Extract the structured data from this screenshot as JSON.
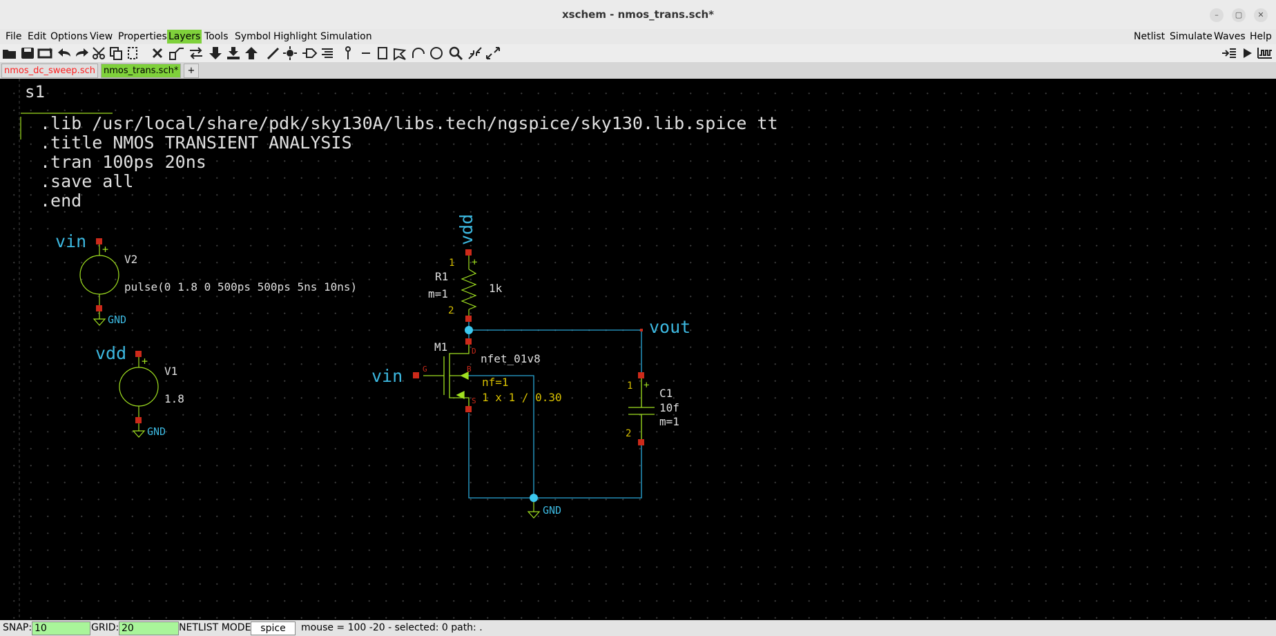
{
  "window": {
    "title": "xschem - nmos_trans.sch*"
  },
  "menubar": {
    "left": [
      "File",
      "Edit",
      "Options",
      "View",
      "Properties",
      "Layers",
      "Tools",
      "Symbol",
      "Highlight",
      "Simulation"
    ],
    "right": [
      "Netlist",
      "Simulate",
      "Waves",
      "Help"
    ],
    "highlighted": "Layers"
  },
  "tabs": [
    {
      "label": "nmos_dc_sweep.sch",
      "color": "#ff2020"
    },
    {
      "label": "nmos_trans.sch*",
      "active": true
    },
    {
      "label": "+"
    }
  ],
  "schematic": {
    "code_block": {
      "name": "s1",
      "lines": [
        ".lib /usr/local/share/pdk/sky130A/libs.tech/ngspice/sky130.lib.spice tt",
        ".title NMOS TRANSIENT ANALYSIS",
        ".tran 100ps 20ns",
        ".save all",
        ".end"
      ]
    },
    "v2": {
      "name": "V2",
      "value": "pulse(0 1.8 0 500ps 500ps 5ns 10ns)",
      "net_top": "vin",
      "net_bottom": "GND"
    },
    "v1": {
      "name": "V1",
      "value": "1.8",
      "net_top": "vdd",
      "net_bottom": "GND"
    },
    "r1": {
      "name": "R1",
      "mult": "m=1",
      "value": "1k",
      "pin1": "1",
      "pin2": "2",
      "net_top": "vdd"
    },
    "m1": {
      "name": "M1",
      "model": "nfet_01v8",
      "nf": "nf=1",
      "size": "1 x 1 / 0.30",
      "pin_d": "D",
      "pin_g": "G",
      "pin_b": "B",
      "pin_s": "S",
      "net_gate": "vin"
    },
    "c1": {
      "name": "C1",
      "value": "10f",
      "mult": "m=1",
      "pin1": "1",
      "pin2": "2"
    },
    "net_out": "vout",
    "gnd_bottom": "GND"
  },
  "status": {
    "snap_label": "SNAP:",
    "snap_value": "10",
    "grid_label": "GRID:",
    "grid_value": "20",
    "netlist_label": "NETLIST MODE:",
    "netlist_value": "spice",
    "message": "mouse = 100 -20 - selected: 0 path: ."
  },
  "colors": {
    "wire": "#2aa8d8",
    "component": "#a0e020",
    "pin": "#cc2a1a",
    "net_label": "#3cb8e0",
    "attr": "#e0e0e0",
    "pin_num": "#d8c000"
  }
}
